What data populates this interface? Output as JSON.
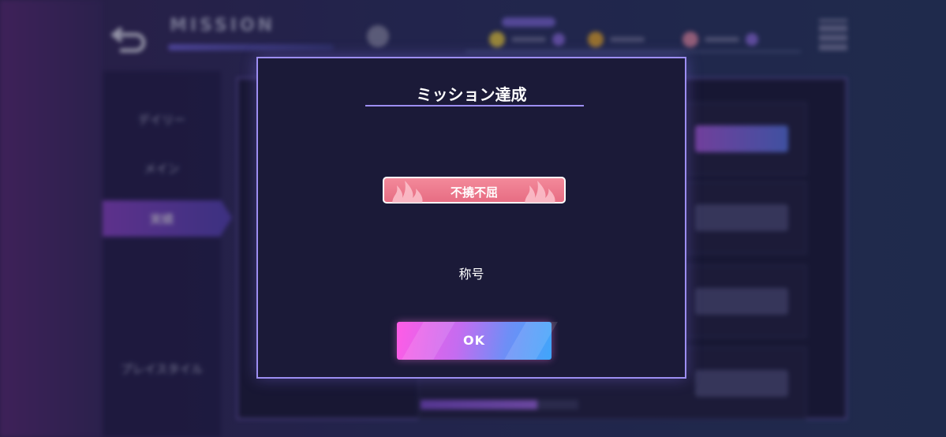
{
  "header": {
    "title": "MISSION"
  },
  "sidebar": {
    "tabs": [
      {
        "label": "デイリー"
      },
      {
        "label": "メイン"
      },
      {
        "label": "実績"
      },
      {
        "label": "プレイスタイル"
      }
    ],
    "active_tab": "実績"
  },
  "modal": {
    "title": "ミッション達成",
    "reward_badge": "不撓不屈",
    "reward_type": "称号",
    "ok_label": "OK"
  },
  "colors": {
    "modal_border": "#9d8ef2",
    "badge_bg": "#e76d83",
    "ok_gradient_start": "#ff5ce6",
    "ok_gradient_end": "#3fa6fb"
  }
}
